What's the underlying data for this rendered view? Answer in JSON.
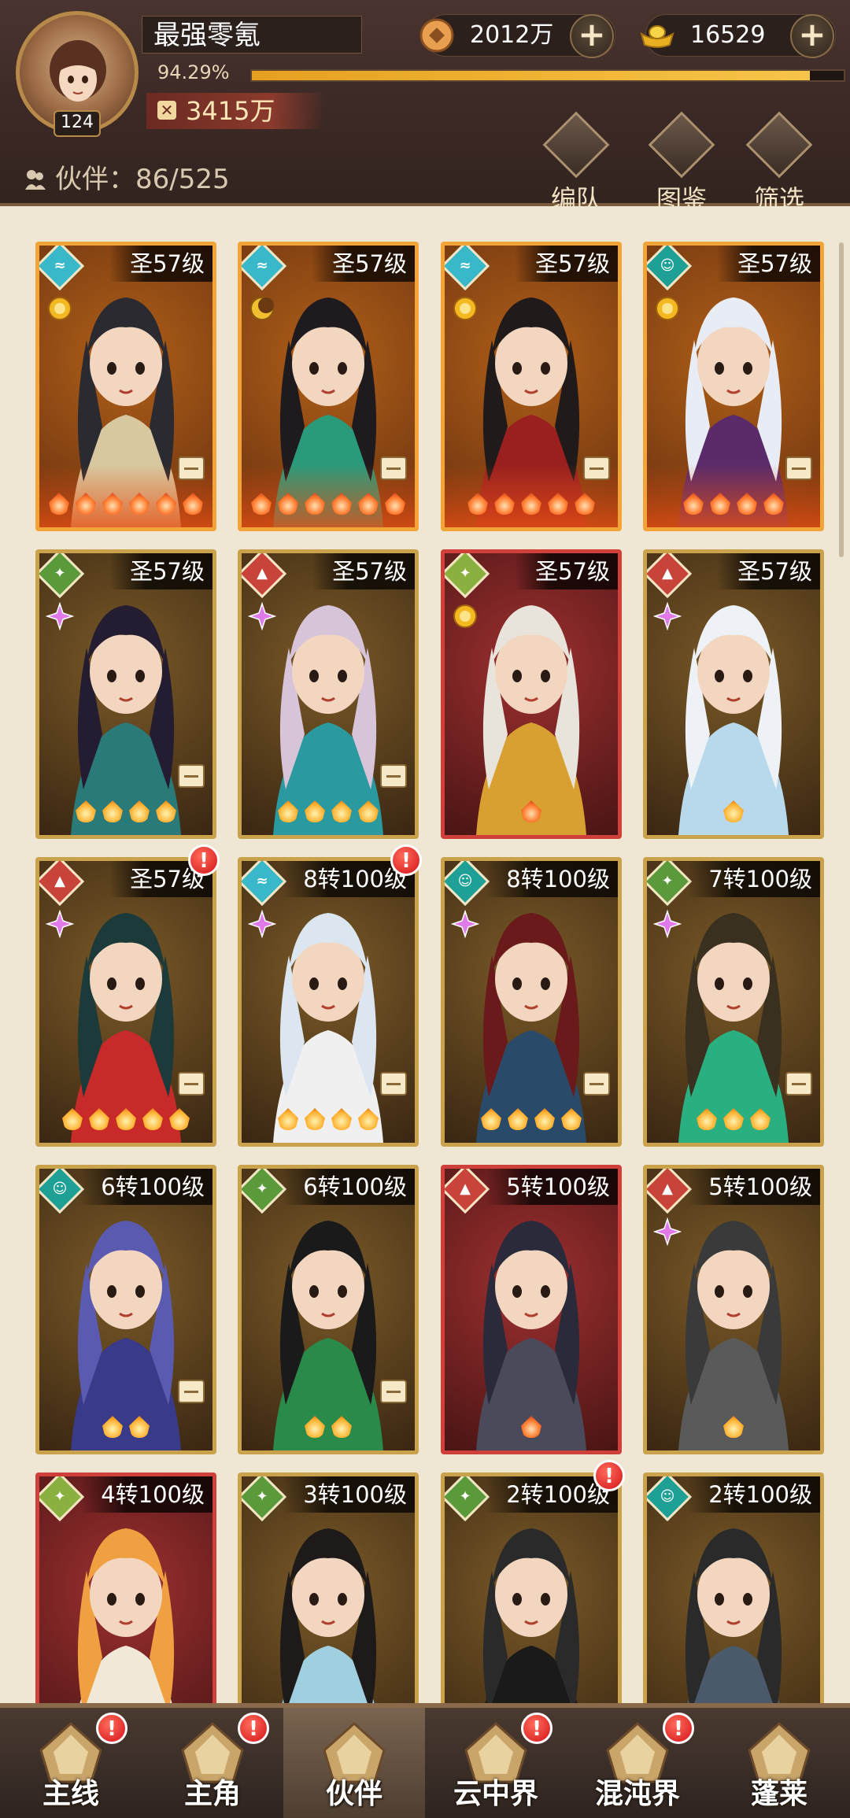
{
  "header": {
    "player_name": "最强零氪",
    "level": "124",
    "exp_percent": "94.29%",
    "exp_progress": 0.9429,
    "power": "3415万",
    "copper": "2012万",
    "gold": "16529",
    "partner_label": "伙伴：86/525",
    "actions": [
      {
        "label": "编队",
        "icon": "formation-icon"
      },
      {
        "label": "图鉴",
        "icon": "codex-icon"
      },
      {
        "label": "筛选",
        "icon": "filter-icon"
      }
    ]
  },
  "cards": [
    {
      "level": "圣57级",
      "element": "water",
      "elcolor": "#38b8c8",
      "frame": "orange",
      "stars": 6,
      "gem": "sun",
      "alert": false,
      "hair": "#2a2a30",
      "robe": "#d8c8a0"
    },
    {
      "level": "圣57级",
      "element": "water",
      "elcolor": "#38b8c8",
      "frame": "orange",
      "stars": 6,
      "gem": "moon",
      "alert": false,
      "hair": "#1e1a1e",
      "robe": "#2a9a7a"
    },
    {
      "level": "圣57级",
      "element": "water",
      "elcolor": "#38b8c8",
      "frame": "orange",
      "stars": 5,
      "gem": "sun",
      "alert": false,
      "hair": "#201a1a",
      "robe": "#9a2020"
    },
    {
      "level": "圣57级",
      "element": "ghost",
      "elcolor": "#1fa096",
      "frame": "orange",
      "stars": 4,
      "gem": "sun",
      "alert": false,
      "hair": "#e8ecf4",
      "robe": "#5a2a6a"
    },
    {
      "level": "圣57级",
      "element": "wind",
      "elcolor": "#5a9a3a",
      "frame": "gold",
      "stars": 4,
      "gem": "spark",
      "alert": false,
      "hair": "#241c30",
      "robe": "#2a7a7a"
    },
    {
      "level": "圣57级",
      "element": "fox",
      "elcolor": "#c8443a",
      "frame": "gold",
      "stars": 4,
      "gem": "spark",
      "alert": false,
      "hair": "#d8c4d8",
      "robe": "#2a9aa0"
    },
    {
      "level": "圣57级",
      "element": "wind",
      "elcolor": "#8ab040",
      "frame": "red",
      "stars": 1,
      "gem": "sun",
      "alert": false,
      "hair": "#e8e4dc",
      "robe": "#d8a030"
    },
    {
      "level": "圣57级",
      "element": "fox",
      "elcolor": "#c8443a",
      "frame": "gold",
      "stars": 1,
      "gem": "spark",
      "alert": false,
      "hair": "#eef2f6",
      "robe": "#b8d8ec"
    },
    {
      "level": "圣57级",
      "element": "fox",
      "elcolor": "#c8443a",
      "frame": "gold",
      "stars": 5,
      "gem": "spark",
      "alert": true,
      "hair": "#1c3a3a",
      "robe": "#c82a2a"
    },
    {
      "level": "8转100级",
      "element": "water",
      "elcolor": "#38b8c8",
      "frame": "gold",
      "stars": 4,
      "gem": "spark",
      "alert": true,
      "hair": "#dce6f0",
      "robe": "#f0f0f0"
    },
    {
      "level": "8转100级",
      "element": "ghost",
      "elcolor": "#1fa096",
      "frame": "gold",
      "stars": 4,
      "gem": "spark",
      "alert": false,
      "hair": "#6a1a1a",
      "robe": "#2a4a6a"
    },
    {
      "level": "7转100级",
      "element": "wind",
      "elcolor": "#5a9a3a",
      "frame": "gold",
      "stars": 3,
      "gem": "spark",
      "alert": false,
      "hair": "#3a3020",
      "robe": "#2ab080"
    },
    {
      "level": "6转100级",
      "element": "ghost",
      "elcolor": "#1fa096",
      "frame": "gold",
      "stars": 2,
      "gem": "none",
      "alert": false,
      "hair": "#5a5ab0",
      "robe": "#3a3a8a"
    },
    {
      "level": "6转100级",
      "element": "wind",
      "elcolor": "#5a9a3a",
      "frame": "gold",
      "stars": 2,
      "gem": "none",
      "alert": false,
      "hair": "#1a1a1a",
      "robe": "#2a8a4a"
    },
    {
      "level": "5转100级",
      "element": "fox",
      "elcolor": "#c8443a",
      "frame": "red",
      "stars": 1,
      "gem": "none",
      "alert": false,
      "hair": "#2a2a3a",
      "robe": "#4a4a5a"
    },
    {
      "level": "5转100级",
      "element": "fox",
      "elcolor": "#c8443a",
      "frame": "gold",
      "stars": 1,
      "gem": "spark",
      "alert": false,
      "hair": "#3a3a3a",
      "robe": "#5a5a5a"
    },
    {
      "level": "4转100级",
      "element": "wind",
      "elcolor": "#8ab040",
      "frame": "red",
      "stars": 0,
      "gem": "none",
      "alert": false,
      "hair": "#f0a040",
      "robe": "#f0e8d8"
    },
    {
      "level": "3转100级",
      "element": "wind",
      "elcolor": "#5a9a3a",
      "frame": "gold",
      "stars": 0,
      "gem": "none",
      "alert": false,
      "hair": "#1e1a1a",
      "robe": "#a0d0e0"
    },
    {
      "level": "2转100级",
      "element": "wind",
      "elcolor": "#5a9a3a",
      "frame": "gold",
      "stars": 0,
      "gem": "none",
      "alert": true,
      "hair": "#2a2a2a",
      "robe": "#1a1a1a"
    },
    {
      "level": "2转100级",
      "element": "ghost",
      "elcolor": "#1fa096",
      "frame": "gold",
      "stars": 0,
      "gem": "none",
      "alert": false,
      "hair": "#2a2a2a",
      "robe": "#4a5a6a"
    }
  ],
  "nav": [
    {
      "label": "主线",
      "alert": true,
      "active": false,
      "icon": "swords-icon"
    },
    {
      "label": "主角",
      "alert": true,
      "active": false,
      "icon": "hero-icon"
    },
    {
      "label": "伙伴",
      "alert": false,
      "active": true,
      "icon": "partner-helmet-icon"
    },
    {
      "label": "云中界",
      "alert": true,
      "active": false,
      "icon": "pavilion-icon"
    },
    {
      "label": "混沌界",
      "alert": true,
      "active": false,
      "icon": "chaos-gate-icon"
    },
    {
      "label": "蓬莱",
      "alert": false,
      "active": false,
      "icon": "sage-icon"
    }
  ],
  "colors": {
    "accent_gold": "#f7c548",
    "alert_red": "#d4141a",
    "grid_bg": "#efe6d4"
  }
}
